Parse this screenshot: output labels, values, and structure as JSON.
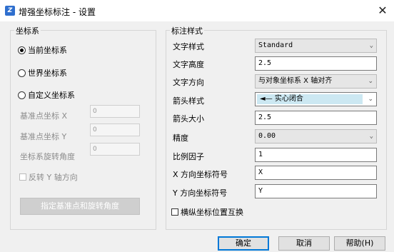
{
  "window": {
    "title": "增强坐标标注 - 设置",
    "close": "✕"
  },
  "coordsys": {
    "legend": "坐标系",
    "options": [
      "当前坐标系",
      "世界坐标系",
      "自定义坐标系"
    ],
    "selected": 0,
    "base_x_label": "基准点坐标 X",
    "base_x_value": "0",
    "base_y_label": "基准点坐标 Y",
    "base_y_value": "0",
    "rotation_label": "坐标系旋转角度",
    "rotation_value": "0",
    "flip_y_label": "反转 Y 轴方向",
    "pick_button": "指定基准点和旋转角度"
  },
  "style": {
    "legend": "标注样式",
    "text_style_label": "文字样式",
    "text_style_value": "Standard",
    "text_height_label": "文字高度",
    "text_height_value": "2.5",
    "text_dir_label": "文字方向",
    "text_dir_value": "与对象坐标系 X 轴对齐",
    "arrow_style_label": "箭头样式",
    "arrow_style_value": "实心闭合",
    "arrow_size_label": "箭头大小",
    "arrow_size_value": "2.5",
    "precision_label": "精度",
    "precision_value": "0.00",
    "scale_label": "比例因子",
    "scale_value": "1",
    "x_symbol_label": "X 方向坐标符号",
    "x_symbol_value": "X",
    "y_symbol_label": "Y 方向坐标符号",
    "y_symbol_value": "Y",
    "swap_label": "横纵坐标位置互换"
  },
  "buttons": {
    "ok": "确定",
    "cancel": "取消",
    "help": "帮助(H)"
  },
  "colors": {
    "accent": "#0078d7",
    "arrow_highlight": "#cce8f2"
  }
}
